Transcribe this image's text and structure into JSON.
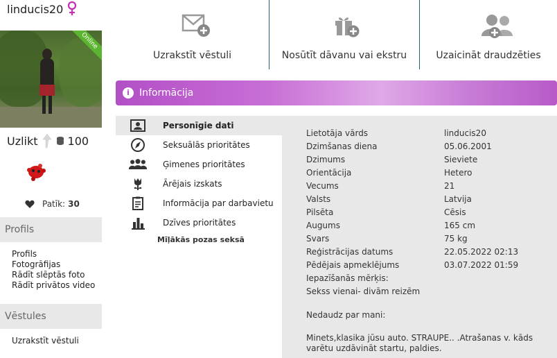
{
  "profile": {
    "username": "linducis20",
    "online_badge": "Online",
    "uzlikt_label": "Uzlikt",
    "coins": "100",
    "likes_label": "Patīk:",
    "likes_count": "30"
  },
  "sidebar": {
    "profile_header": "Profils",
    "profile_links": [
      "Profils",
      "Fotogrāfijas",
      "Rādīt slēptās foto",
      "Rādīt privātos video"
    ],
    "messages_header": "Vēstules",
    "messages_links": [
      "Uzrakstīt vēstuli"
    ]
  },
  "actions": [
    {
      "label": "Uzrakstīt vēstuli",
      "icon": "envelope-plus-icon"
    },
    {
      "label": "Nosūtīt dāvanu vai ekstru",
      "icon": "gift-plus-icon"
    },
    {
      "label": "Uzaicināt draudzēties",
      "icon": "add-friend-icon"
    }
  ],
  "info_bar": {
    "title": "Informācija"
  },
  "tabs": [
    {
      "label": "Personīgie dati",
      "icon": "id-card-icon",
      "active": true
    },
    {
      "label": "Seksuālās prioritātes",
      "icon": "compass-icon",
      "active": false
    },
    {
      "label": "Ģimenes prioritātes",
      "icon": "family-icon",
      "active": false
    },
    {
      "label": "Ārējais izskats",
      "icon": "tulip-icon",
      "active": false
    },
    {
      "label": "Informācija par darbavietu",
      "icon": "clipboard-icon",
      "active": false
    },
    {
      "label": "Dzīves prioritātes",
      "icon": "bar-chart-icon",
      "active": false
    }
  ],
  "tab_sub": "Mīļākās pozas seksā",
  "details": [
    {
      "key": "Lietotāja vārds",
      "value": "linducis20"
    },
    {
      "key": "Dzimšanas diena",
      "value": "05.06.2001"
    },
    {
      "key": "Dzimums",
      "value": "Sieviete"
    },
    {
      "key": "Orientācija",
      "value": "Hetero"
    },
    {
      "key": "Vecums",
      "value": "21"
    },
    {
      "key": "Valsts",
      "value": "Latvija"
    },
    {
      "key": "Pilsēta",
      "value": "Cēsis"
    },
    {
      "key": "Augums",
      "value": "165 cm"
    },
    {
      "key": "Svars",
      "value": "75 kg"
    },
    {
      "key": "Reģistrācijas datums",
      "value": "22.05.2022 02:13"
    },
    {
      "key": "Pēdējais apmeklējums",
      "value": "03.07.2022 01:59"
    },
    {
      "key": "Iepazīšanās mērķis:",
      "value": ""
    },
    {
      "key": "Sekss vienai- divām reizēm",
      "value": ""
    }
  ],
  "about_label": "Nedaudz par mani:",
  "about_text": "Minets,klasika jūsu auto. STRAUPE.. .Atrašanas v. kāds varētu uzdāvināt startu, paldies.",
  "colors": {
    "accent": "#b24fc6",
    "online": "#5cb531",
    "panel": "#e8e8e8",
    "divider": "#2a5a7a",
    "female": "#c030b0"
  }
}
